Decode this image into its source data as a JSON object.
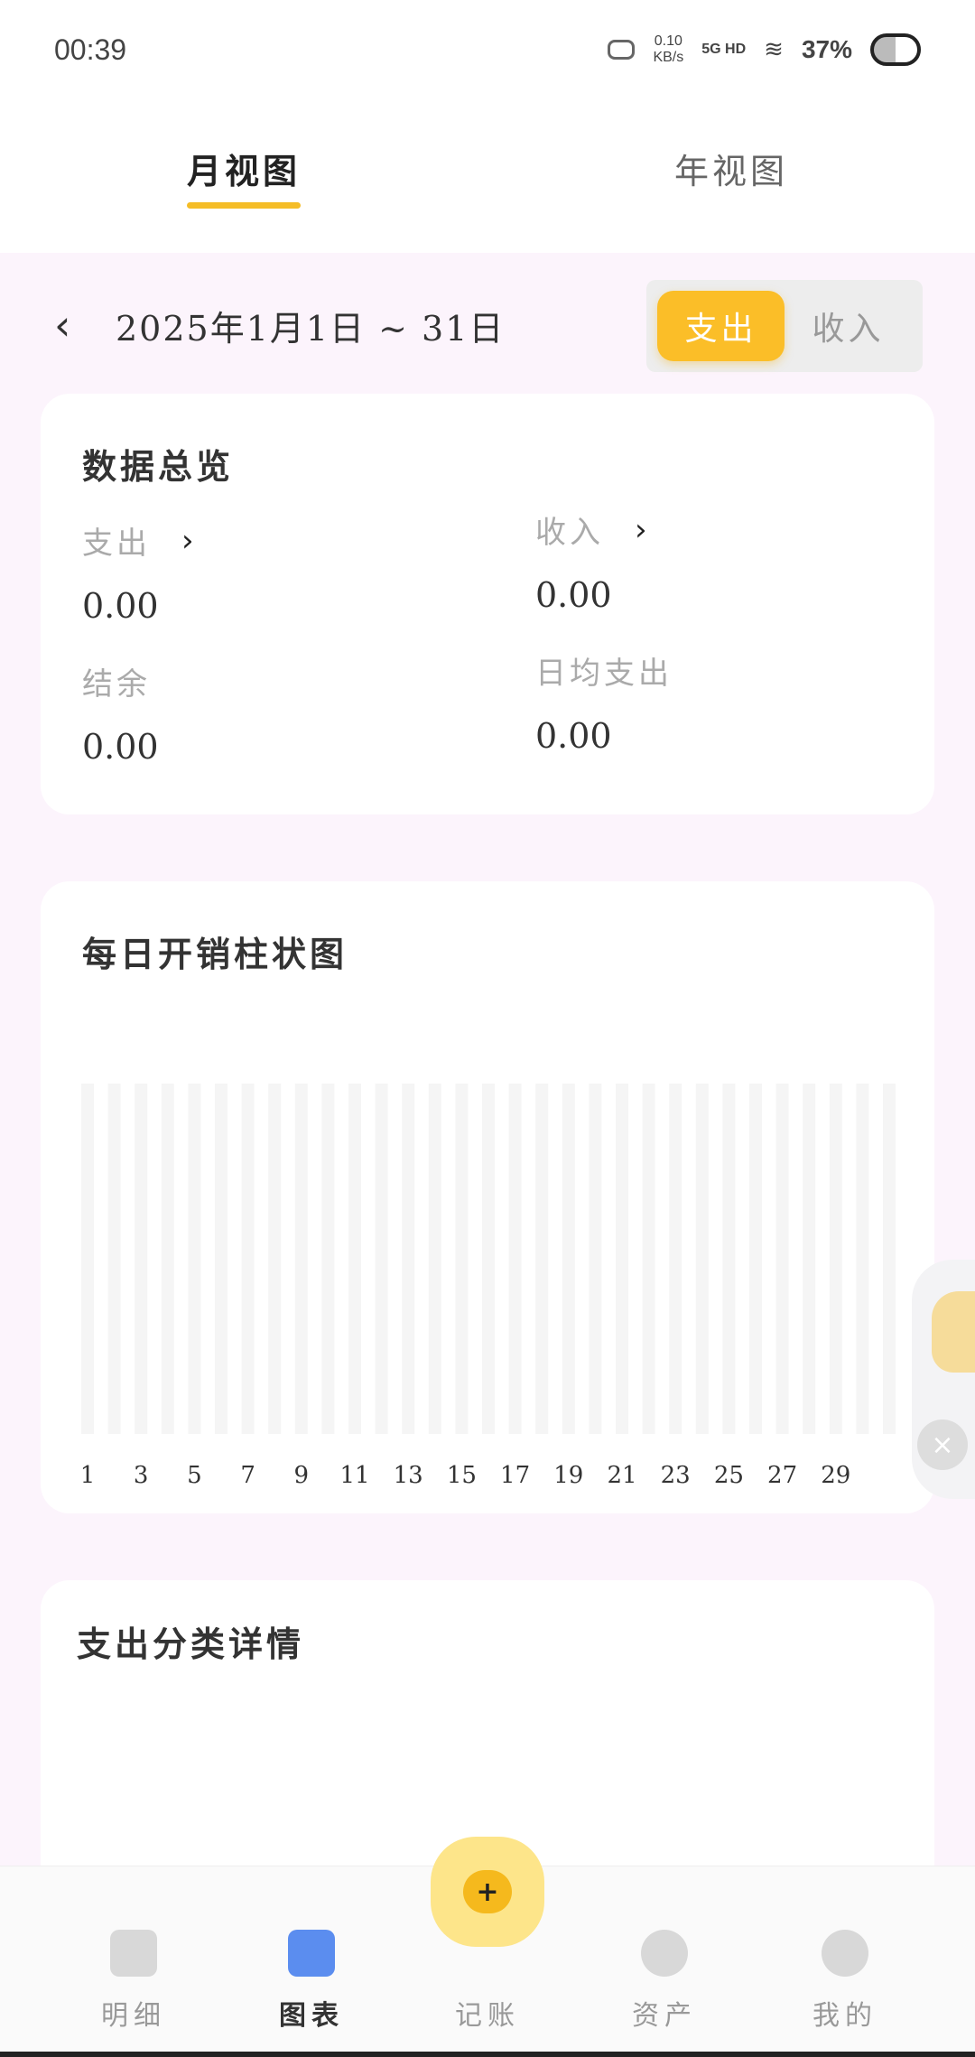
{
  "status_bar": {
    "time": "00:39",
    "net_speed_value": "0.10",
    "net_speed_unit": "KB/s",
    "signal": "5G HD",
    "battery": "37%"
  },
  "top_tabs": [
    {
      "label": "月视图",
      "active": true
    },
    {
      "label": "年视图",
      "active": false
    }
  ],
  "date_range": "2025年1月1日 ~ 31日",
  "segment": {
    "expense": "支出",
    "income": "收入",
    "selected": "expense"
  },
  "overview": {
    "title": "数据总览",
    "expense_label": "支出",
    "expense_value": "0.00",
    "income_label": "收入",
    "income_value": "0.00",
    "balance_label": "结余",
    "balance_value": "0.00",
    "daily_avg_label": "日均支出",
    "daily_avg_value": "0.00"
  },
  "bar_chart_title": "每日开销柱状图",
  "chart_data": {
    "type": "bar",
    "categories": [
      "1",
      "2",
      "3",
      "4",
      "5",
      "6",
      "7",
      "8",
      "9",
      "10",
      "11",
      "12",
      "13",
      "14",
      "15",
      "16",
      "17",
      "18",
      "19",
      "20",
      "21",
      "22",
      "23",
      "24",
      "25",
      "26",
      "27",
      "28",
      "29",
      "30",
      "31"
    ],
    "values": [
      0,
      0,
      0,
      0,
      0,
      0,
      0,
      0,
      0,
      0,
      0,
      0,
      0,
      0,
      0,
      0,
      0,
      0,
      0,
      0,
      0,
      0,
      0,
      0,
      0,
      0,
      0,
      0,
      0,
      0,
      0
    ],
    "tick_labels": [
      "1",
      "3",
      "5",
      "7",
      "9",
      "11",
      "13",
      "15",
      "17",
      "19",
      "21",
      "23",
      "25",
      "27",
      "29"
    ],
    "colors": {
      "track": "#f5f5f5"
    }
  },
  "category_card_title": "支出分类详情",
  "bottom_nav": [
    {
      "label": "明细",
      "icon": "document-icon",
      "active": false
    },
    {
      "label": "图表",
      "icon": "bar-chart-icon",
      "active": true
    },
    {
      "label": "记账",
      "icon": "add-record-icon",
      "active": false
    },
    {
      "label": "资产",
      "icon": "piggy-bank-icon",
      "active": false
    },
    {
      "label": "我的",
      "icon": "profile-icon",
      "active": false
    }
  ],
  "fab_icon": "+",
  "close_icon": "×",
  "colors": {
    "accent": "#fbbe28",
    "background": "#fcf4fc",
    "nav_active": "#5b8def"
  }
}
